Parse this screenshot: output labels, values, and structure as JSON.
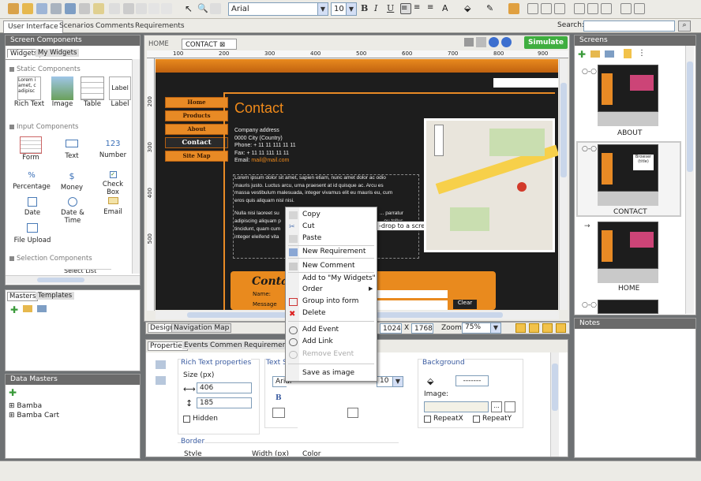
{
  "toolbar": {
    "font": "Arial",
    "size": "10",
    "bold": "B",
    "italic": "I",
    "underline": "U"
  },
  "tabs": [
    "User Interface",
    "Scenarios",
    "Comments",
    "Requirements"
  ],
  "search": {
    "label": "Search:",
    "placeholder": ""
  },
  "left": {
    "title": "Screen Components",
    "tabs": [
      "Widgets",
      "My Widgets"
    ],
    "sections": {
      "static": "Static Components",
      "input": "Input Components",
      "selection": "Selection Components"
    },
    "widgets": [
      "Rich Text",
      "Image",
      "Table",
      "Label",
      "Form",
      "Text",
      "Number",
      "Percentage",
      "Money",
      "Check Box",
      "Date",
      "Date & Time",
      "Email",
      "File Upload"
    ],
    "widget_glyphs": {
      "label": "Label",
      "number": "123",
      "percentage": "%",
      "money": "$"
    },
    "rich_text_sample": [
      "Lorem i",
      "amet, c",
      "adipisc"
    ],
    "clipped_item": "Select List"
  },
  "masters": {
    "tabs": [
      "Masters",
      "Templates"
    ]
  },
  "datamasters": {
    "title": "Data Masters",
    "items": [
      "Bamba",
      "Bamba Cart"
    ]
  },
  "center": {
    "tabs": [
      "HOME",
      "CONTACT"
    ],
    "simulate": "Simulate",
    "ruler": [
      "100",
      "200",
      "300",
      "400",
      "500",
      "600",
      "700",
      "800",
      "900"
    ],
    "vruler": [
      "200",
      "300",
      "400",
      "500"
    ],
    "bottomtabs": [
      "Design",
      "Navigation Map"
    ],
    "w": "1024",
    "x": "X",
    "h": "1768",
    "zoom_label": "Zoom:",
    "zoom": "75%"
  },
  "mock": {
    "nav": [
      "Home",
      "Products",
      "About",
      "Contact",
      "Site Map"
    ],
    "title": "Contact",
    "addr": [
      "Company address",
      "0000 City (Country)",
      "Phone: + 11 11 111 11 11",
      "Fax: + 11 11 111 11 11"
    ],
    "email_label": "Email:",
    "email": "mail@mail.com",
    "lorem": [
      "Lorem ipsum dolor sit amet, sapien etiam, nunc amet dolor ac odio",
      "mauris justo. Luctus arcu, urna praesent at id quisque ac. Arcu es",
      "massa vestibulum malesuada, integer vivamus elit eu mauris eu, cum",
      "eros quis aliquam nisl nisi."
    ],
    "lorem2": [
      "Nulla nisi laoreet su",
      "adipiscing aliquam p",
      "tincidunt, quam cum",
      "integer eleifend vita"
    ],
    "lorem2_right": [
      "... parratur",
      "...eu tellus"
    ],
    "tooltip": "-drop to a screen",
    "form_title": "Conta",
    "form_fields": [
      "Name:",
      "Message"
    ],
    "form_button": "Clear"
  },
  "menu": {
    "items": [
      "Copy",
      "Cut",
      "Paste",
      "New Requirement",
      "New Comment",
      "Add to \"My Widgets\"",
      "Order",
      "Group into form",
      "Delete",
      "Add Event",
      "Add Link",
      "Remove Event",
      "Save as image"
    ]
  },
  "props": {
    "tabs": [
      "Properties",
      "Events",
      "Comments",
      "Requirements"
    ],
    "richtext": "Rich Text properties",
    "size": "Size (px)",
    "width": "406",
    "height": "185",
    "hidden": "Hidden",
    "textst": "Text St",
    "font": "Arial",
    "fsize": "10",
    "border": "Border",
    "style": "Style",
    "widthpx": "Width (px)",
    "color": "Color",
    "background": "Background",
    "bgcolor": "-------",
    "image": "Image:",
    "browse": "...",
    "repeatx": "RepeatX",
    "repeaty": "RepeatY"
  },
  "screens": {
    "title": "Screens",
    "items": [
      "ABOUT",
      "CONTACT",
      "HOME"
    ],
    "thumb_balloon": [
      "Browser",
      "(title)"
    ]
  },
  "notes": {
    "title": "Notes"
  }
}
